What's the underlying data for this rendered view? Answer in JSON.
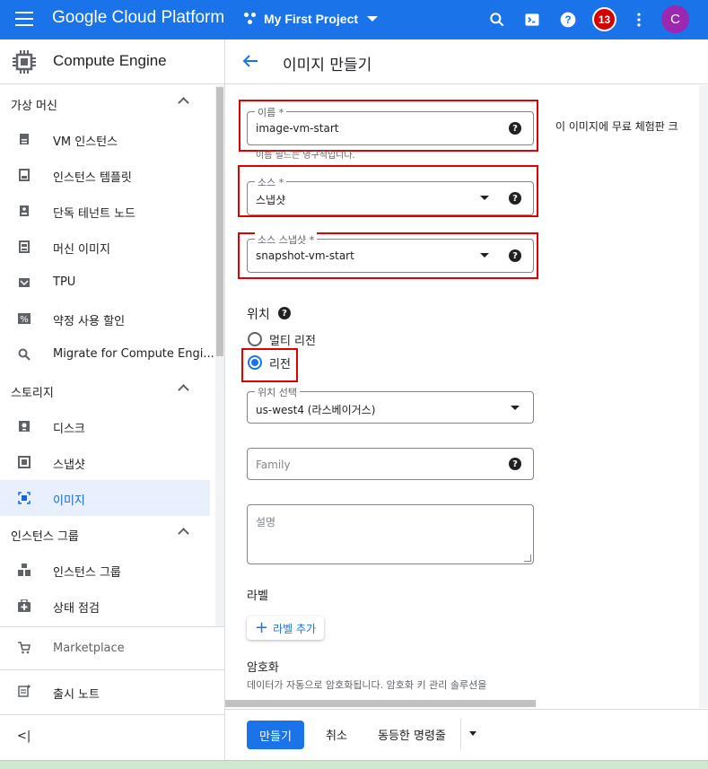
{
  "topbar": {
    "brand": "Google Cloud Platform",
    "project": "My First Project",
    "notification_count": "13",
    "avatar_initial": "C"
  },
  "sidebar": {
    "title": "Compute Engine",
    "sections": [
      {
        "label": "가상 머신",
        "items": [
          "VM 인스턴스",
          "인스턴스 템플릿",
          "단독 테넌트 노드",
          "머신 이미지",
          "TPU",
          "약정 사용 할인",
          "Migrate for Compute Engi..."
        ]
      },
      {
        "label": "스토리지",
        "items": [
          "디스크",
          "스냅샷",
          "이미지"
        ]
      },
      {
        "label": "인스턴스 그룹",
        "items": [
          "인스턴스 그룹",
          "상태 점검"
        ]
      }
    ],
    "marketplace": "Marketplace",
    "release_notes": "출시 노트",
    "collapse": "<|"
  },
  "page": {
    "title": "이미지 만들기",
    "side_note": "이 이미지에 무료 체험판 크"
  },
  "form": {
    "name": {
      "label": "이름 *",
      "value": "image-vm-start",
      "hint": "이름 필드는 영구적입니다."
    },
    "source": {
      "label": "소스 *",
      "value": "스냅샷"
    },
    "source_snapshot": {
      "label": "소스 스냅샷 *",
      "value": "snapshot-vm-start"
    },
    "location": {
      "title": "위치",
      "options": [
        "멀티 리전",
        "리전"
      ],
      "selected": "리전",
      "select_label": "위치 선택",
      "select_value": "us-west4 (라스베이거스)"
    },
    "family": {
      "placeholder": "Family"
    },
    "description": {
      "placeholder": "설명"
    },
    "labels": {
      "title": "라벨",
      "add_button": "라벨 추가"
    },
    "encryption": {
      "title": "암호화",
      "desc": "데이터가 자동으로 암호화됩니다. 암호화 키 관리 솔루션을"
    }
  },
  "footer": {
    "create": "만들기",
    "cancel": "취소",
    "equivalent": "동등한 명령줄"
  },
  "colors": {
    "accent": "#1a73e8",
    "highlight": "#e00000",
    "topbar": "#1a73e8"
  }
}
